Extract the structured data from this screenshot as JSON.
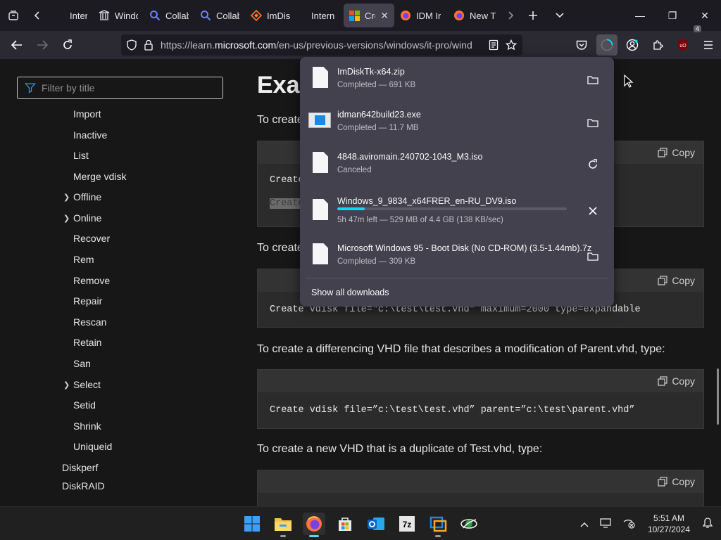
{
  "tabs": [
    {
      "title": "Intern",
      "icon": "generic-page-icon"
    },
    {
      "title": "Windo",
      "icon": "library-icon"
    },
    {
      "title": "Collab",
      "icon": "search-icon"
    },
    {
      "title": "Collab",
      "icon": "search-icon"
    },
    {
      "title": "ImDis",
      "icon": "diamond-icon"
    },
    {
      "title": "Intern",
      "icon": "generic-page-icon"
    },
    {
      "title": "Cre",
      "icon": "microsoft-logo-icon",
      "active": true
    },
    {
      "title": "IDM Ir",
      "icon": "firefox-icon"
    },
    {
      "title": "New T",
      "icon": "firefox-icon"
    }
  ],
  "url": {
    "prefix": "https://learn.",
    "domain": "microsoft.com",
    "suffix": "/en-us/previous-versions/windows/it-pro/wind"
  },
  "extensions_badge": "4",
  "sidebar": {
    "filter_placeholder": "Filter by title",
    "items": [
      {
        "label": "Import",
        "chevron": false
      },
      {
        "label": "Inactive",
        "chevron": false
      },
      {
        "label": "List",
        "chevron": false
      },
      {
        "label": "Merge vdisk",
        "chevron": false
      },
      {
        "label": "Offline",
        "chevron": true
      },
      {
        "label": "Online",
        "chevron": true
      },
      {
        "label": "Recover",
        "chevron": false
      },
      {
        "label": "Rem",
        "chevron": false
      },
      {
        "label": "Remove",
        "chevron": false
      },
      {
        "label": "Repair",
        "chevron": false
      },
      {
        "label": "Rescan",
        "chevron": false
      },
      {
        "label": "Retain",
        "chevron": false
      },
      {
        "label": "San",
        "chevron": false
      },
      {
        "label": "Select",
        "chevron": true
      },
      {
        "label": "Setid",
        "chevron": false
      },
      {
        "label": "Shrink",
        "chevron": false
      },
      {
        "label": "Uniqueid",
        "chevron": false
      },
      {
        "label": "Diskperf",
        "chevron": false,
        "level": 0
      },
      {
        "label": "DiskRAID",
        "chevron": false,
        "level": 0
      }
    ]
  },
  "article": {
    "heading": "Exar",
    "para1": "To create",
    "code1_line1": "Create",
    "code1_line2": "Create",
    "para2": "To create",
    "code2": "Create vdisk file=\"c:\\test\\test.vhd\" maximum=2000 type=expandable",
    "para3": "To create a differencing VHD file that describes a modification of Parent.vhd, type:",
    "code3": "Create vdisk file=”c:\\test\\test.vhd” parent=”c:\\test\\parent.vhd”",
    "para4": "To create a new VHD that is a duplicate of Test.vhd, type:",
    "copy_label": "Copy"
  },
  "downloads": {
    "items": [
      {
        "name": "ImDiskTk-x64.zip",
        "status": "Completed — 691 KB",
        "action": "folder-icon",
        "type": "file"
      },
      {
        "name": "idman642build23.exe",
        "status": "Completed — 11.7 MB",
        "action": "folder-icon",
        "type": "exe"
      },
      {
        "name": "4848.aviromain.240702-1043_M3.iso",
        "status": "Canceled",
        "action": "retry-icon",
        "type": "file"
      },
      {
        "name": "Windows_9_9834_x64FRER_en-RU_DV9.iso",
        "status": "5h 47m left — 529 MB of 4.4 GB (138 KB/sec)",
        "action": "cancel-icon",
        "type": "file",
        "progress": 0.12
      },
      {
        "name": "Microsoft Windows 95 - Boot Disk (No CD-ROM) (3.5-1.44mb).7z",
        "status": "Completed — 309 KB",
        "action": "folder-icon",
        "type": "file"
      }
    ],
    "show_all": "Show all downloads"
  },
  "taskbar": {
    "apps": [
      "start-icon",
      "file-explorer-icon",
      "firefox-icon",
      "microsoft-store-icon",
      "outlook-icon",
      "7zip-icon",
      "virtualbox-icon",
      "network-globe-icon"
    ],
    "time": "5:51 AM",
    "date": "10/27/2024"
  }
}
